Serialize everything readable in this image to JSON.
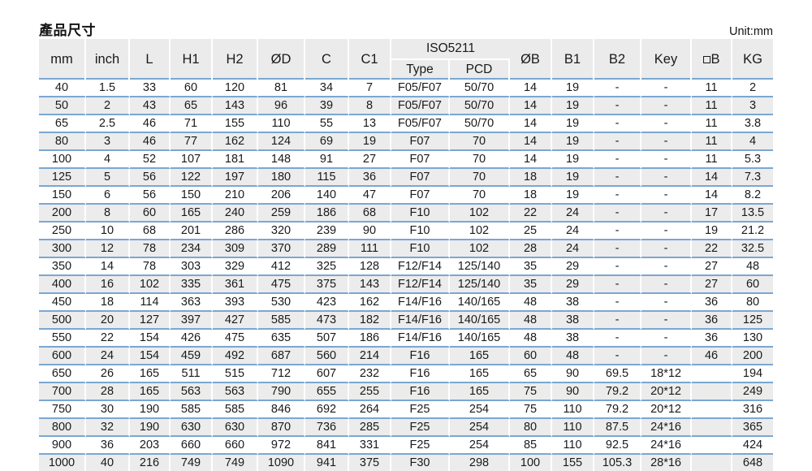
{
  "header": {
    "title": "產品尺寸",
    "unit": "Unit:mm"
  },
  "table": {
    "columns": [
      {
        "key": "mm",
        "label": "mm"
      },
      {
        "key": "inch",
        "label": "inch"
      },
      {
        "key": "L",
        "label": "L"
      },
      {
        "key": "H1",
        "label": "H1"
      },
      {
        "key": "H2",
        "label": "H2"
      },
      {
        "key": "OD",
        "label": "ØD"
      },
      {
        "key": "C",
        "label": "C"
      },
      {
        "key": "C1",
        "label": "C1"
      },
      {
        "key": "type",
        "label": "Type"
      },
      {
        "key": "pcd",
        "label": "PCD"
      },
      {
        "key": "OB",
        "label": "ØB"
      },
      {
        "key": "B1",
        "label": "B1"
      },
      {
        "key": "B2",
        "label": "B2"
      },
      {
        "key": "Key",
        "label": "Key"
      },
      {
        "key": "sqB",
        "label": "□B"
      },
      {
        "key": "KG",
        "label": "KG"
      }
    ],
    "group_header": "ISO5211",
    "rows": [
      [
        "40",
        "1.5",
        "33",
        "60",
        "120",
        "81",
        "34",
        "7",
        "F05/F07",
        "50/70",
        "14",
        "19",
        "-",
        "-",
        "11",
        "2"
      ],
      [
        "50",
        "2",
        "43",
        "65",
        "143",
        "96",
        "39",
        "8",
        "F05/F07",
        "50/70",
        "14",
        "19",
        "-",
        "-",
        "11",
        "3"
      ],
      [
        "65",
        "2.5",
        "46",
        "71",
        "155",
        "110",
        "55",
        "13",
        "F05/F07",
        "50/70",
        "14",
        "19",
        "-",
        "-",
        "11",
        "3.8"
      ],
      [
        "80",
        "3",
        "46",
        "77",
        "162",
        "124",
        "69",
        "19",
        "F07",
        "70",
        "14",
        "19",
        "-",
        "-",
        "11",
        "4"
      ],
      [
        "100",
        "4",
        "52",
        "107",
        "181",
        "148",
        "91",
        "27",
        "F07",
        "70",
        "14",
        "19",
        "-",
        "-",
        "11",
        "5.3"
      ],
      [
        "125",
        "5",
        "56",
        "122",
        "197",
        "180",
        "115",
        "36",
        "F07",
        "70",
        "18",
        "19",
        "-",
        "-",
        "14",
        "7.3"
      ],
      [
        "150",
        "6",
        "56",
        "150",
        "210",
        "206",
        "140",
        "47",
        "F07",
        "70",
        "18",
        "19",
        "-",
        "-",
        "14",
        "8.2"
      ],
      [
        "200",
        "8",
        "60",
        "165",
        "240",
        "259",
        "186",
        "68",
        "F10",
        "102",
        "22",
        "24",
        "-",
        "-",
        "17",
        "13.5"
      ],
      [
        "250",
        "10",
        "68",
        "201",
        "286",
        "320",
        "239",
        "90",
        "F10",
        "102",
        "25",
        "24",
        "-",
        "-",
        "19",
        "21.2"
      ],
      [
        "300",
        "12",
        "78",
        "234",
        "309",
        "370",
        "289",
        "111",
        "F10",
        "102",
        "28",
        "24",
        "-",
        "-",
        "22",
        "32.5"
      ],
      [
        "350",
        "14",
        "78",
        "303",
        "329",
        "412",
        "325",
        "128",
        "F12/F14",
        "125/140",
        "35",
        "29",
        "-",
        "-",
        "27",
        "48"
      ],
      [
        "400",
        "16",
        "102",
        "335",
        "361",
        "475",
        "375",
        "143",
        "F12/F14",
        "125/140",
        "35",
        "29",
        "-",
        "-",
        "27",
        "60"
      ],
      [
        "450",
        "18",
        "114",
        "363",
        "393",
        "530",
        "423",
        "162",
        "F14/F16",
        "140/165",
        "48",
        "38",
        "-",
        "-",
        "36",
        "80"
      ],
      [
        "500",
        "20",
        "127",
        "397",
        "427",
        "585",
        "473",
        "182",
        "F14/F16",
        "140/165",
        "48",
        "38",
        "-",
        "-",
        "36",
        "125"
      ],
      [
        "550",
        "22",
        "154",
        "426",
        "475",
        "635",
        "507",
        "186",
        "F14/F16",
        "140/165",
        "48",
        "38",
        "-",
        "-",
        "36",
        "130"
      ],
      [
        "600",
        "24",
        "154",
        "459",
        "492",
        "687",
        "560",
        "214",
        "F16",
        "165",
        "60",
        "48",
        "-",
        "-",
        "46",
        "200"
      ],
      [
        "650",
        "26",
        "165",
        "511",
        "515",
        "712",
        "607",
        "232",
        "F16",
        "165",
        "65",
        "90",
        "69.5",
        "18*12",
        "",
        "194"
      ],
      [
        "700",
        "28",
        "165",
        "563",
        "563",
        "790",
        "655",
        "255",
        "F16",
        "165",
        "75",
        "90",
        "79.2",
        "20*12",
        "",
        "249"
      ],
      [
        "750",
        "30",
        "190",
        "585",
        "585",
        "846",
        "692",
        "264",
        "F25",
        "254",
        "75",
        "110",
        "79.2",
        "20*12",
        "",
        "316"
      ],
      [
        "800",
        "32",
        "190",
        "630",
        "630",
        "870",
        "736",
        "285",
        "F25",
        "254",
        "80",
        "110",
        "87.5",
        "24*16",
        "",
        "365"
      ],
      [
        "900",
        "36",
        "203",
        "660",
        "660",
        "972",
        "841",
        "331",
        "F25",
        "254",
        "85",
        "110",
        "92.5",
        "24*16",
        "",
        "424"
      ],
      [
        "1000",
        "40",
        "216",
        "749",
        "749",
        "1090",
        "941",
        "375",
        "F30",
        "298",
        "100",
        "155",
        "105.3",
        "28*16",
        "",
        "648"
      ]
    ]
  },
  "colors": {
    "header_bg": "#ebebeb",
    "row_alt_bg": "#ececec",
    "rule_blue": "#7aa7d2",
    "text": "#1a1a1a"
  }
}
